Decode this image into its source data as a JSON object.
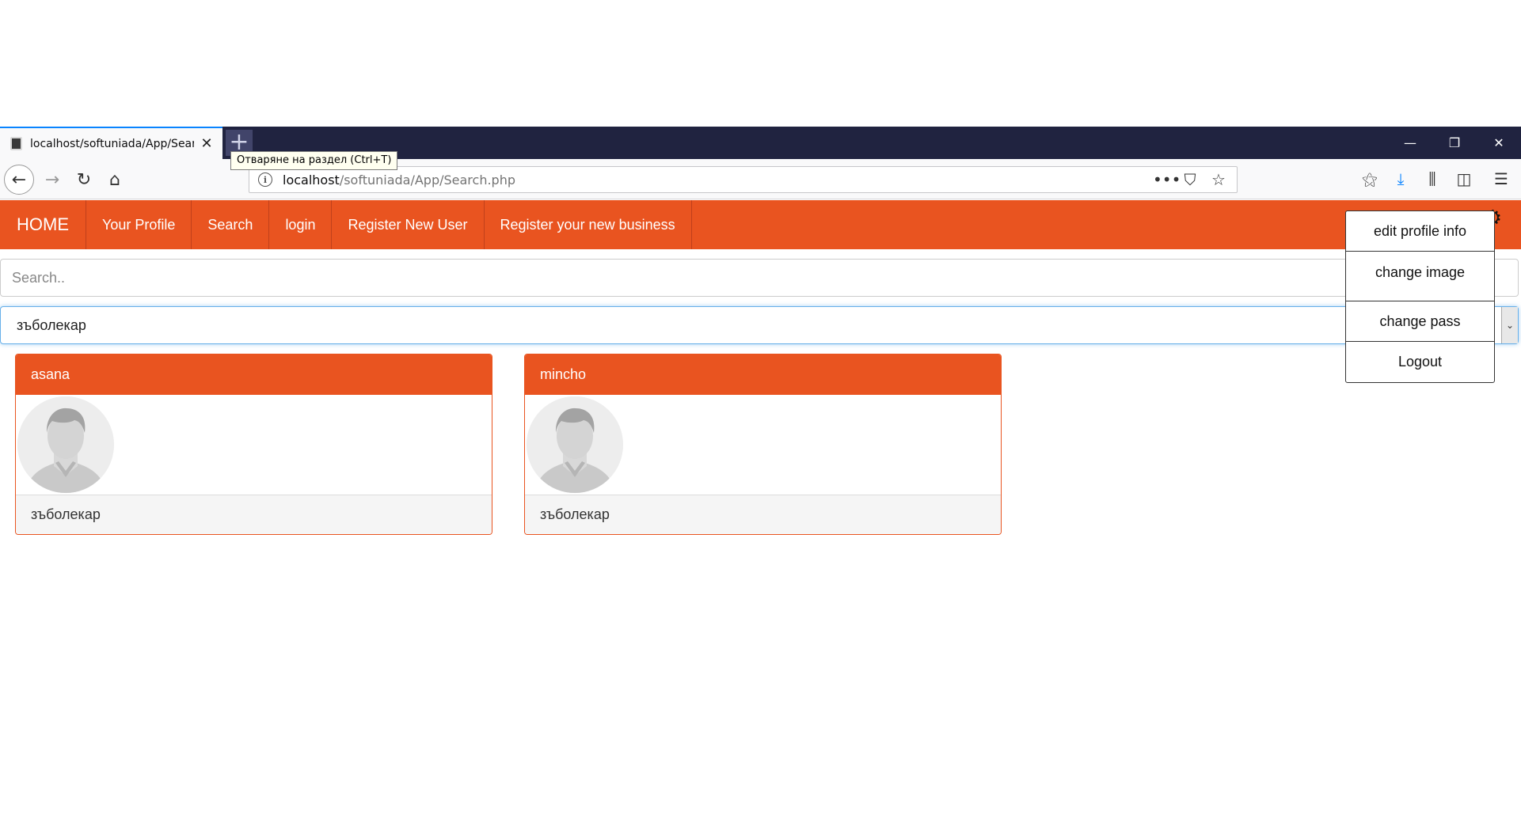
{
  "browser": {
    "tab_title": "localhost/softuniada/App/Search.php",
    "tooltip": "Отваряне на раздел (Ctrl+T)",
    "url_host": "localhost",
    "url_path": "/softuniada/App/Search.php"
  },
  "site": {
    "nav": [
      "HOME",
      "Your Profile",
      "Search",
      "login",
      "Register New User",
      "Register your new business"
    ],
    "search_placeholder": "Search..",
    "selected_category": "зъболекар",
    "accent_color": "#e95420"
  },
  "dropdown": [
    "edit profile info",
    "change image",
    "change pass",
    "Logout"
  ],
  "results": [
    {
      "name": "asana",
      "category": "зъболекар"
    },
    {
      "name": "mincho",
      "category": "зъболекар"
    }
  ]
}
